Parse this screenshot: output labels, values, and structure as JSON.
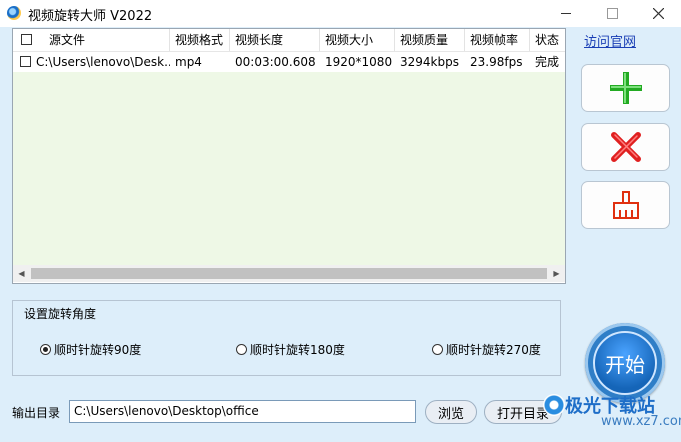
{
  "window": {
    "title": "视频旋转大师 V2022"
  },
  "file_table": {
    "columns": [
      "源文件",
      "视频格式",
      "视频长度",
      "视频大小",
      "视频质量",
      "视频帧率",
      "状态"
    ],
    "rows": [
      {
        "checked": false,
        "source": "C:\\Users\\lenovo\\Desk...",
        "format": "mp4",
        "length": "00:03:00.608",
        "size": "1920*1080",
        "quality": "3294kbps",
        "fps": "23.98fps",
        "status": "完成"
      }
    ]
  },
  "sidebar": {
    "official_link": "访问官网",
    "add_icon": "plus-icon",
    "delete_icon": "x-icon",
    "clear_icon": "broom-icon",
    "colors": {
      "add": "#22aa22",
      "delete": "#e02020",
      "clear": "#e03010"
    }
  },
  "rotation": {
    "group_title": "设置旋转角度",
    "options": [
      {
        "label": "顺时针旋转90度",
        "selected": true
      },
      {
        "label": "顺时针旋转180度",
        "selected": false
      },
      {
        "label": "顺时针旋转270度",
        "selected": false
      }
    ]
  },
  "start_button": {
    "label": "开始"
  },
  "output": {
    "label": "输出目录",
    "path": "C:\\Users\\lenovo\\Desktop\\office",
    "browse_label": "浏览",
    "open_label": "打开目录"
  },
  "watermark": {
    "title": "极光下载站",
    "url": "www.xz7.com"
  }
}
